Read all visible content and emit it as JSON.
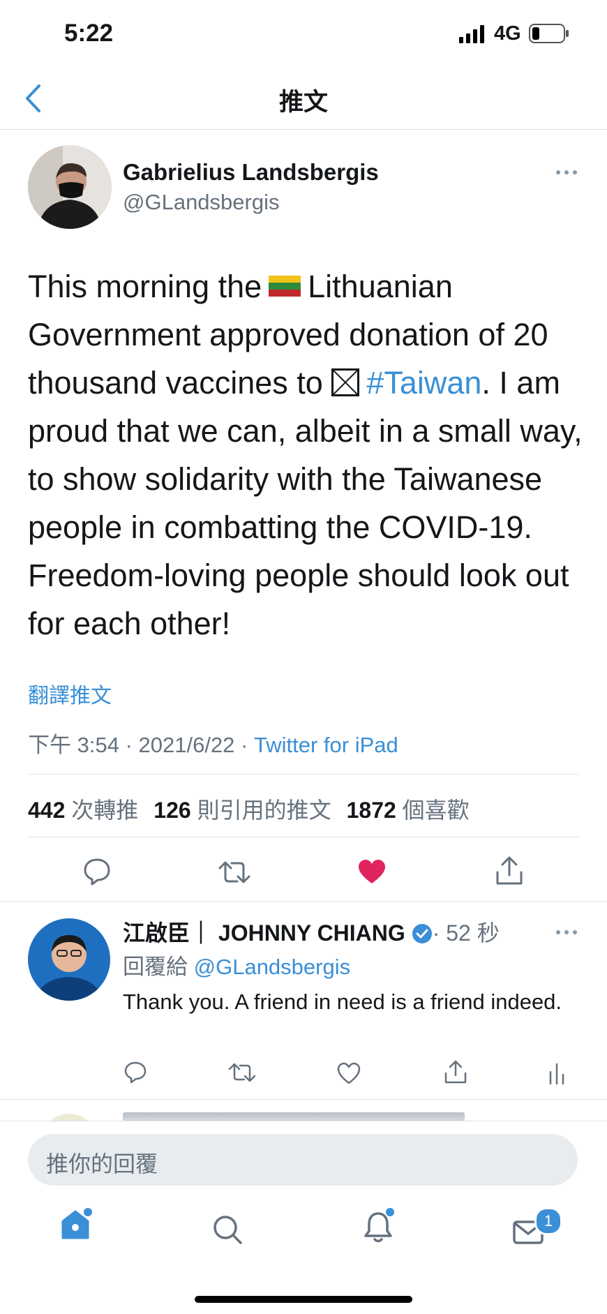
{
  "status_bar": {
    "time": "5:22",
    "network": "4G"
  },
  "nav": {
    "title": "推文",
    "back_icon": "chevron-left-icon"
  },
  "tweet": {
    "author_name": "Gabrielius Landsbergis",
    "author_handle": "@GLandsbergis",
    "text_part1": "This morning the",
    "text_part2": "Lithuanian Government approved donation of 20 thousand vaccines to",
    "hashtag": "#Taiwan",
    "text_part3": ". I am proud that we can, albeit in a small way, to show solidarity with the Taiwanese people in combatting the COVID-19. Freedom-loving people should look out for each other!",
    "translate_label": "翻譯推文",
    "time": "下午 3:54",
    "date": "2021/6/22",
    "source": "Twitter for iPad",
    "retweets": "442",
    "retweets_label": "次轉推",
    "quotes": "126",
    "quotes_label": "則引用的推文",
    "likes": "1872",
    "likes_label": "個喜歡",
    "liked": true
  },
  "reply": {
    "author_name": "江啟臣｜ JOHNNY CHIANG",
    "verified": true,
    "time": "· 52 秒",
    "reply_to_label": "回覆給",
    "reply_to_handle": "@GLandsbergis",
    "text": "Thank you. A friend in need is a friend indeed."
  },
  "composer": {
    "placeholder": "推你的回覆"
  },
  "tab_bar": {
    "items": [
      "home-icon",
      "search-icon",
      "bell-icon",
      "mail-icon"
    ],
    "messages_badge": "1"
  },
  "colors": {
    "accent": "#3a8fd6",
    "like": "#e0245e",
    "muted": "#65717d"
  }
}
